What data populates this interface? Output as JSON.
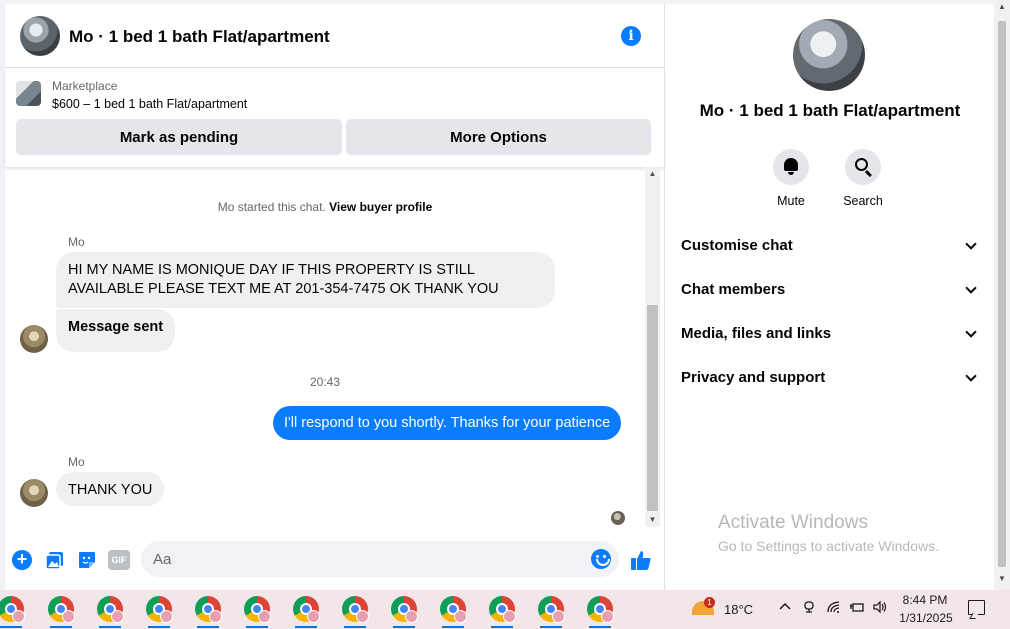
{
  "chat": {
    "title": "Mo · 1 bed 1 bath Flat/apartment",
    "marketplace_label": "Marketplace",
    "listing": "$600 – 1 bed 1 bath Flat/apartment",
    "mark_pending_label": "Mark as pending",
    "more_options_label": "More Options",
    "system_note_prefix": "Mo started this chat.",
    "system_note_link": "View buyer profile",
    "messages": [
      {
        "sender": "Mo",
        "text": "HI MY NAME IS MONIQUE DAY IF THIS PROPERTY IS STILL AVAILABLE PLEASE TEXT ME AT 201-354-7475 OK THANK YOU"
      },
      {
        "text": "Message sent"
      },
      {
        "time": "20:43"
      },
      {
        "outgoing": true,
        "text": "I'll respond to you shortly. Thanks for your patience"
      },
      {
        "sender": "Mo",
        "text": "THANK YOU"
      }
    ],
    "composer": {
      "placeholder": "Aa",
      "gif_label": "GIF"
    }
  },
  "side_panel": {
    "title": "Mo · 1 bed 1 bath Flat/apartment",
    "actions": [
      {
        "label": "Mute",
        "icon": "bell-icon"
      },
      {
        "label": "Search",
        "icon": "search-icon"
      }
    ],
    "sections": [
      "Customise chat",
      "Chat members",
      "Media, files and links",
      "Privacy and support"
    ],
    "watermark_title": "Activate Windows",
    "watermark_sub": "Go to Settings to activate Windows."
  },
  "taskbar": {
    "app_icons": [
      "chrome-profile-icon",
      "chrome-profile-icon",
      "chrome-profile-icon",
      "chrome-profile-icon",
      "chrome-profile-icon",
      "chrome-profile-icon",
      "chrome-profile-icon",
      "chrome-profile-icon",
      "chrome-profile-icon",
      "chrome-profile-icon",
      "chrome-profile-icon",
      "chrome-profile-icon",
      "chrome-profile-icon"
    ],
    "weather_badge": "1",
    "temperature": "18°C",
    "time": "8:44 PM",
    "date": "1/31/2025"
  },
  "colors": {
    "accent": "#0a7cff",
    "bubble_in": "#f0f0f0",
    "button_bg": "#e4e6eb",
    "taskbar_bg": "#f3e6e9"
  }
}
